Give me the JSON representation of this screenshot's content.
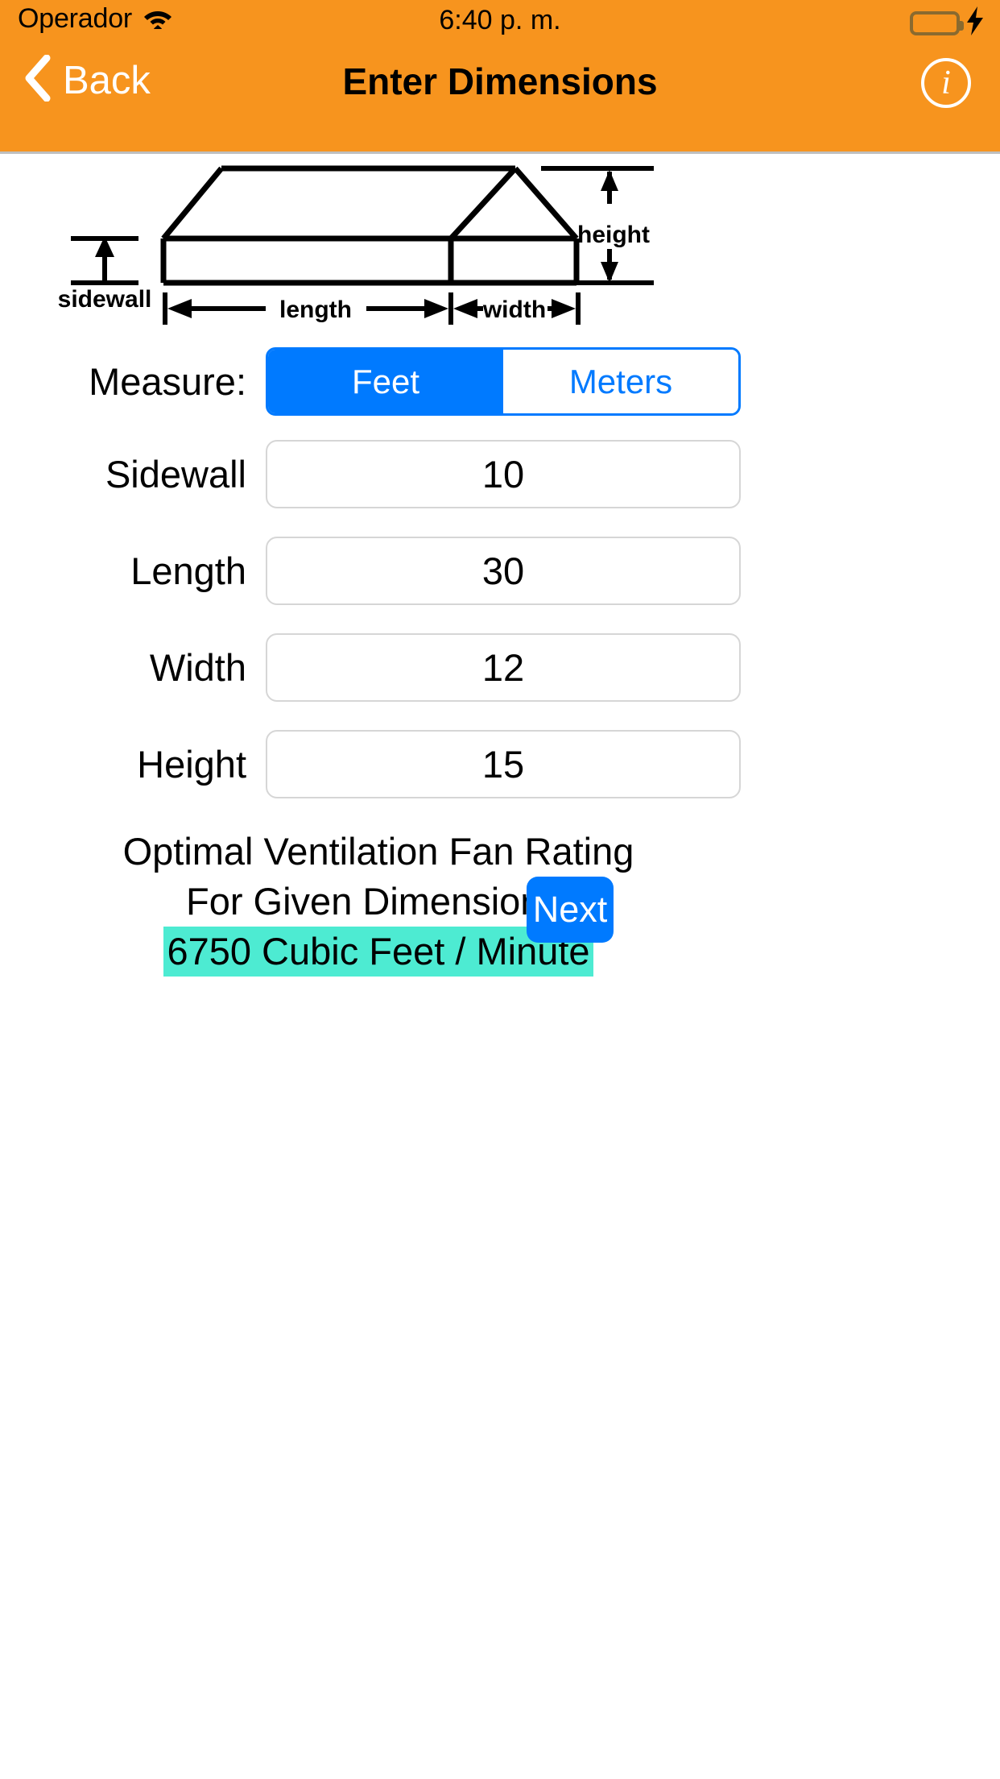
{
  "status_bar": {
    "carrier": "Operador",
    "wifi_icon": "wifi-icon",
    "time": "6:40 p. m.",
    "battery_icon": "battery-full-icon",
    "charging_icon": "lightning-bolt-icon"
  },
  "nav": {
    "back_label": "Back",
    "back_icon": "chevron-left-icon",
    "title": "Enter Dimensions",
    "info_label": "i",
    "info_icon": "info-circle-icon"
  },
  "diagram": {
    "name": "building-dimensions-diagram",
    "labels": {
      "sidewall": "sidewall",
      "height": "height",
      "length": "length",
      "width": "width"
    }
  },
  "measure": {
    "label": "Measure:",
    "options": [
      "Feet",
      "Meters"
    ],
    "selected": "Feet",
    "feet_label": "Feet",
    "meters_label": "Meters"
  },
  "fields": [
    {
      "label": "Sidewall",
      "value": "10",
      "placeholder": ""
    },
    {
      "label": "Length",
      "value": "30",
      "placeholder": ""
    },
    {
      "label": "Width",
      "value": "12",
      "placeholder": ""
    },
    {
      "label": "Height",
      "value": "15",
      "placeholder": ""
    }
  ],
  "result": {
    "line1": "Optimal Ventilation Fan Rating",
    "line2": "For Given Dimensions:",
    "value": "6750 Cubic Feet / Minute",
    "highlight_color": "#4DEBD2"
  },
  "next_button": {
    "label": "Next"
  },
  "colors": {
    "header": "#F7941E",
    "accent_blue": "#007AFF",
    "battery_green": "#4CD964",
    "highlight": "#4DEBD2"
  }
}
